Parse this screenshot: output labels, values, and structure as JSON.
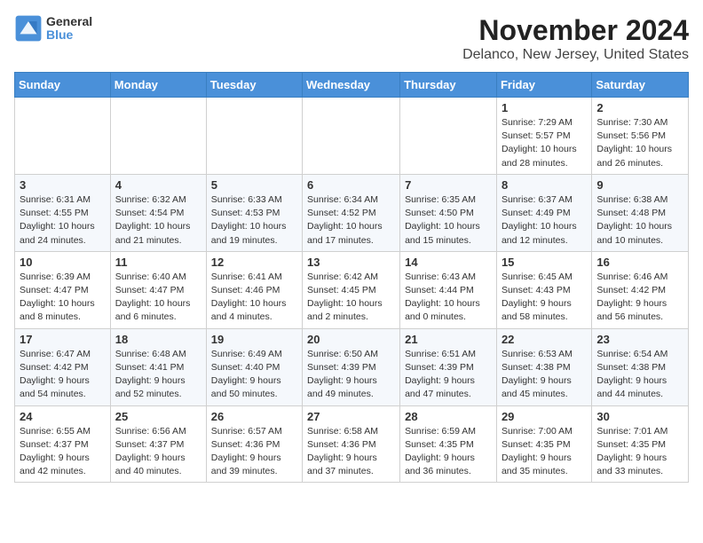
{
  "logo": {
    "line1": "General",
    "line2": "Blue"
  },
  "title": "November 2024",
  "subtitle": "Delanco, New Jersey, United States",
  "weekdays": [
    "Sunday",
    "Monday",
    "Tuesday",
    "Wednesday",
    "Thursday",
    "Friday",
    "Saturday"
  ],
  "weeks": [
    [
      {
        "day": "",
        "info": ""
      },
      {
        "day": "",
        "info": ""
      },
      {
        "day": "",
        "info": ""
      },
      {
        "day": "",
        "info": ""
      },
      {
        "day": "",
        "info": ""
      },
      {
        "day": "1",
        "info": "Sunrise: 7:29 AM\nSunset: 5:57 PM\nDaylight: 10 hours and 28 minutes."
      },
      {
        "day": "2",
        "info": "Sunrise: 7:30 AM\nSunset: 5:56 PM\nDaylight: 10 hours and 26 minutes."
      }
    ],
    [
      {
        "day": "3",
        "info": "Sunrise: 6:31 AM\nSunset: 4:55 PM\nDaylight: 10 hours and 24 minutes."
      },
      {
        "day": "4",
        "info": "Sunrise: 6:32 AM\nSunset: 4:54 PM\nDaylight: 10 hours and 21 minutes."
      },
      {
        "day": "5",
        "info": "Sunrise: 6:33 AM\nSunset: 4:53 PM\nDaylight: 10 hours and 19 minutes."
      },
      {
        "day": "6",
        "info": "Sunrise: 6:34 AM\nSunset: 4:52 PM\nDaylight: 10 hours and 17 minutes."
      },
      {
        "day": "7",
        "info": "Sunrise: 6:35 AM\nSunset: 4:50 PM\nDaylight: 10 hours and 15 minutes."
      },
      {
        "day": "8",
        "info": "Sunrise: 6:37 AM\nSunset: 4:49 PM\nDaylight: 10 hours and 12 minutes."
      },
      {
        "day": "9",
        "info": "Sunrise: 6:38 AM\nSunset: 4:48 PM\nDaylight: 10 hours and 10 minutes."
      }
    ],
    [
      {
        "day": "10",
        "info": "Sunrise: 6:39 AM\nSunset: 4:47 PM\nDaylight: 10 hours and 8 minutes."
      },
      {
        "day": "11",
        "info": "Sunrise: 6:40 AM\nSunset: 4:47 PM\nDaylight: 10 hours and 6 minutes."
      },
      {
        "day": "12",
        "info": "Sunrise: 6:41 AM\nSunset: 4:46 PM\nDaylight: 10 hours and 4 minutes."
      },
      {
        "day": "13",
        "info": "Sunrise: 6:42 AM\nSunset: 4:45 PM\nDaylight: 10 hours and 2 minutes."
      },
      {
        "day": "14",
        "info": "Sunrise: 6:43 AM\nSunset: 4:44 PM\nDaylight: 10 hours and 0 minutes."
      },
      {
        "day": "15",
        "info": "Sunrise: 6:45 AM\nSunset: 4:43 PM\nDaylight: 9 hours and 58 minutes."
      },
      {
        "day": "16",
        "info": "Sunrise: 6:46 AM\nSunset: 4:42 PM\nDaylight: 9 hours and 56 minutes."
      }
    ],
    [
      {
        "day": "17",
        "info": "Sunrise: 6:47 AM\nSunset: 4:42 PM\nDaylight: 9 hours and 54 minutes."
      },
      {
        "day": "18",
        "info": "Sunrise: 6:48 AM\nSunset: 4:41 PM\nDaylight: 9 hours and 52 minutes."
      },
      {
        "day": "19",
        "info": "Sunrise: 6:49 AM\nSunset: 4:40 PM\nDaylight: 9 hours and 50 minutes."
      },
      {
        "day": "20",
        "info": "Sunrise: 6:50 AM\nSunset: 4:39 PM\nDaylight: 9 hours and 49 minutes."
      },
      {
        "day": "21",
        "info": "Sunrise: 6:51 AM\nSunset: 4:39 PM\nDaylight: 9 hours and 47 minutes."
      },
      {
        "day": "22",
        "info": "Sunrise: 6:53 AM\nSunset: 4:38 PM\nDaylight: 9 hours and 45 minutes."
      },
      {
        "day": "23",
        "info": "Sunrise: 6:54 AM\nSunset: 4:38 PM\nDaylight: 9 hours and 44 minutes."
      }
    ],
    [
      {
        "day": "24",
        "info": "Sunrise: 6:55 AM\nSunset: 4:37 PM\nDaylight: 9 hours and 42 minutes."
      },
      {
        "day": "25",
        "info": "Sunrise: 6:56 AM\nSunset: 4:37 PM\nDaylight: 9 hours and 40 minutes."
      },
      {
        "day": "26",
        "info": "Sunrise: 6:57 AM\nSunset: 4:36 PM\nDaylight: 9 hours and 39 minutes."
      },
      {
        "day": "27",
        "info": "Sunrise: 6:58 AM\nSunset: 4:36 PM\nDaylight: 9 hours and 37 minutes."
      },
      {
        "day": "28",
        "info": "Sunrise: 6:59 AM\nSunset: 4:35 PM\nDaylight: 9 hours and 36 minutes."
      },
      {
        "day": "29",
        "info": "Sunrise: 7:00 AM\nSunset: 4:35 PM\nDaylight: 9 hours and 35 minutes."
      },
      {
        "day": "30",
        "info": "Sunrise: 7:01 AM\nSunset: 4:35 PM\nDaylight: 9 hours and 33 minutes."
      }
    ]
  ]
}
